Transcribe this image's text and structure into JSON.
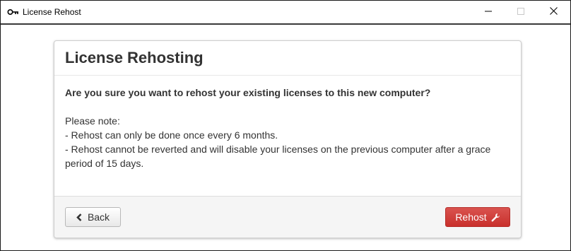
{
  "window": {
    "title": "License Rehost"
  },
  "panel": {
    "title": "License Rehosting",
    "question": "Are you sure you want to rehost your existing licenses to this new computer?",
    "notes": [
      "Please note:",
      "- Rehost can only be done once every 6 months.",
      "- Rehost cannot be reverted and will disable your licenses on the previous computer after a grace period of 15 days."
    ]
  },
  "footer": {
    "back_label": "Back",
    "rehost_label": "Rehost"
  },
  "icons": {
    "app": "key-icon",
    "back": "chevron-left-icon",
    "rehost": "wrench-icon",
    "minimize": "minimize-icon",
    "maximize": "maximize-icon",
    "close": "close-icon"
  },
  "colors": {
    "danger_button": "#d9534f",
    "text": "#333333",
    "footer_bg": "#f5f5f5"
  }
}
